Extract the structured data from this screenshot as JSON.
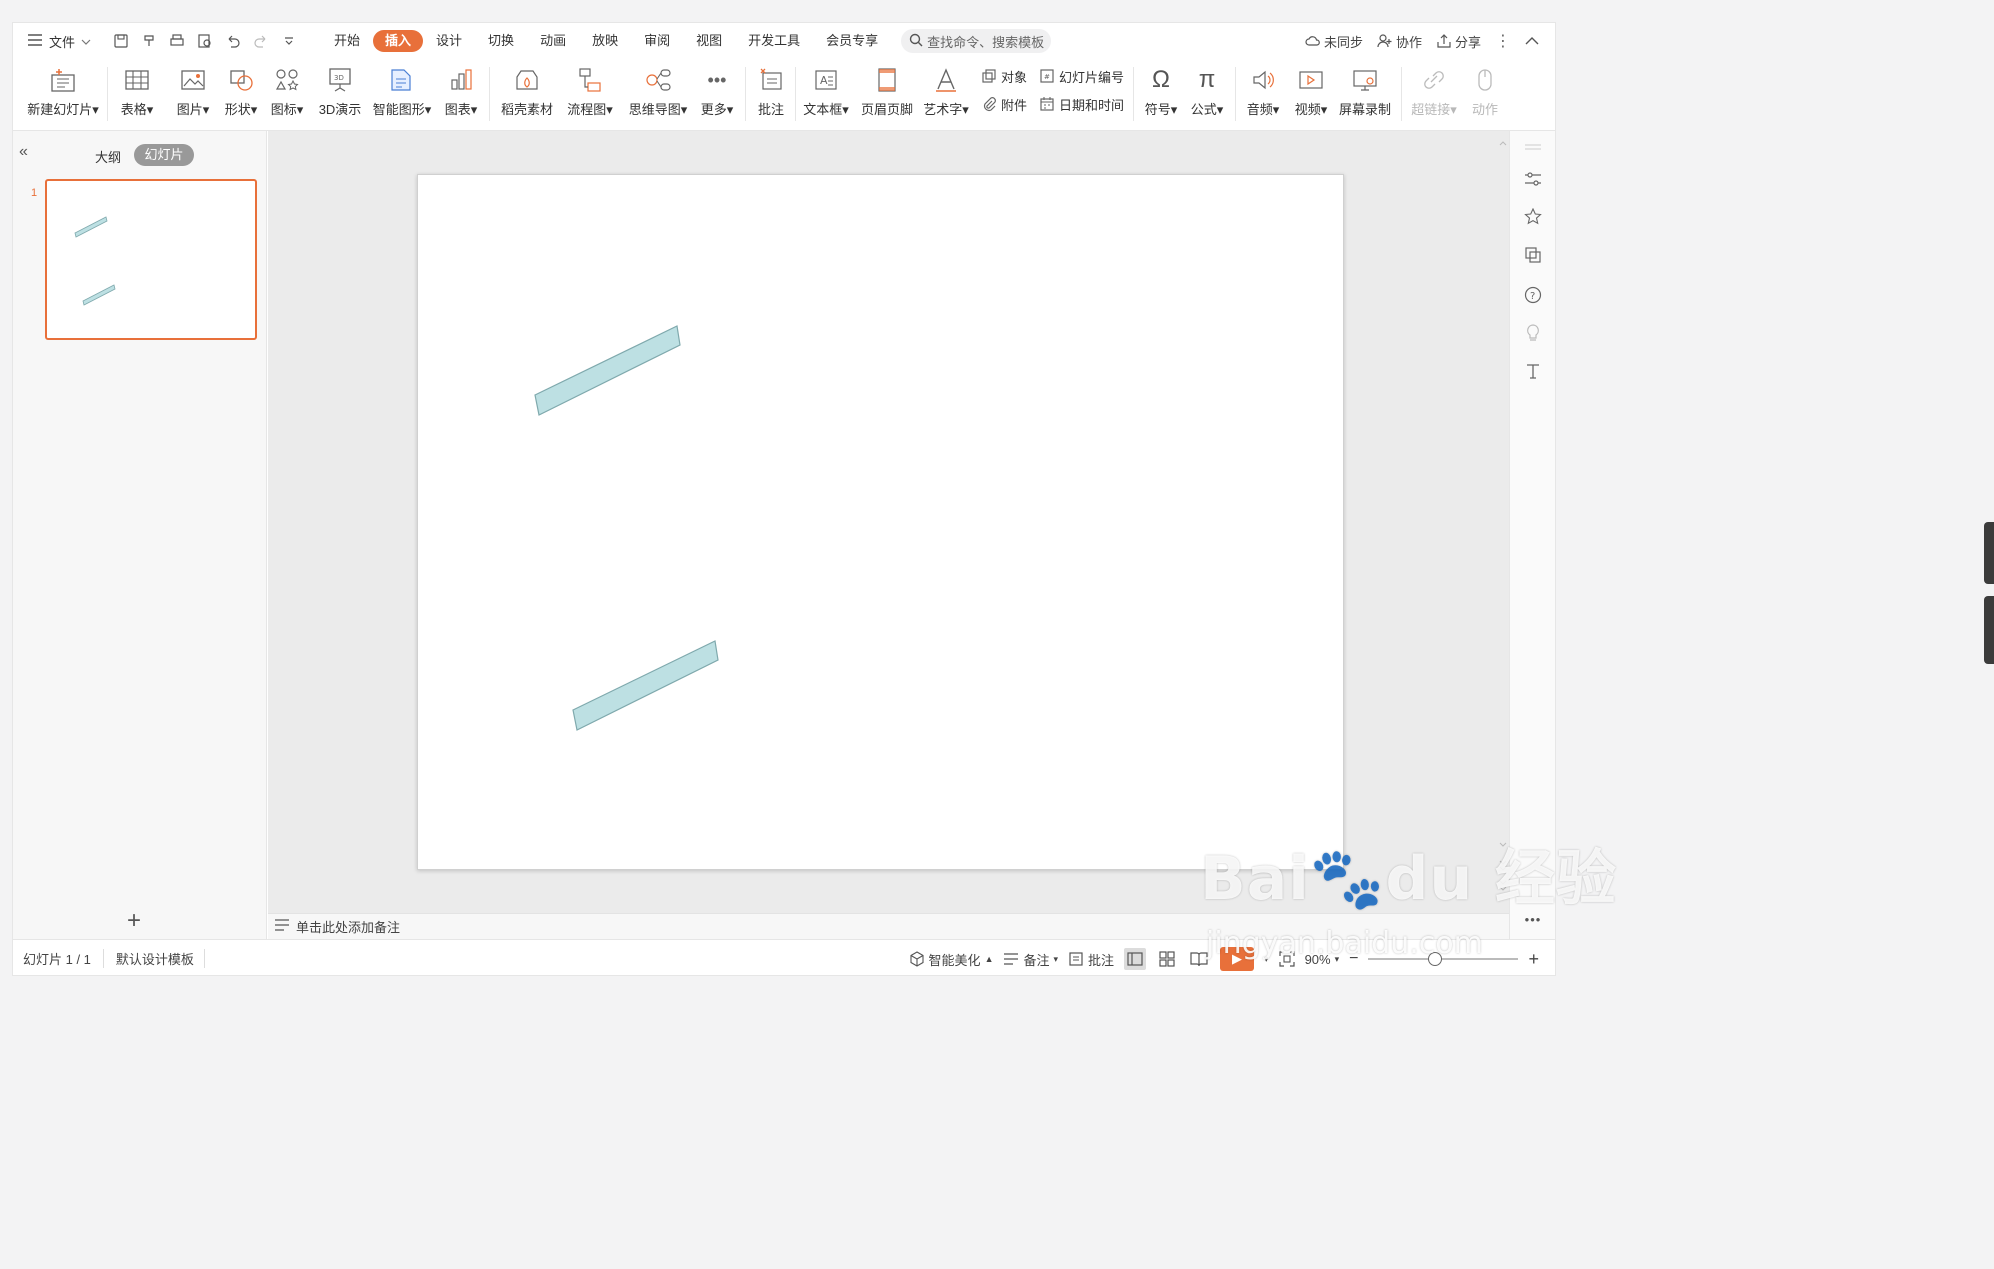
{
  "menubar": {
    "file_label": "文件",
    "tabs": [
      {
        "label": "开始"
      },
      {
        "label": "插入"
      },
      {
        "label": "设计"
      },
      {
        "label": "切换"
      },
      {
        "label": "动画"
      },
      {
        "label": "放映"
      },
      {
        "label": "审阅"
      },
      {
        "label": "视图"
      },
      {
        "label": "开发工具"
      },
      {
        "label": "会员专享"
      }
    ],
    "active_tab": "插入",
    "search_placeholder": "查找命令、搜索模板",
    "sync_label": "未同步",
    "collab_label": "协作",
    "share_label": "分享"
  },
  "ribbon": {
    "new_slide": "新建幻灯片",
    "table": "表格",
    "picture": "图片",
    "shape": "形状",
    "icon": "图标",
    "demo3d": "3D演示",
    "smartart": "智能图形",
    "chart": "图表",
    "material": "稻壳素材",
    "flowchart": "流程图",
    "mindmap": "思维导图",
    "more": "更多",
    "comment": "批注",
    "textbox": "文本框",
    "header_footer": "页眉页脚",
    "wordart": "艺术字",
    "object": "对象",
    "attachment": "附件",
    "slide_number": "幻灯片编号",
    "datetime": "日期和时间",
    "symbol": "符号",
    "formula": "公式",
    "audio": "音频",
    "video": "视频",
    "screen_record": "屏幕录制",
    "hyperlink": "超链接",
    "action": "动作"
  },
  "leftpanel": {
    "outline_label": "大纲",
    "slides_label": "幻灯片",
    "slide_number": "1"
  },
  "notes": {
    "placeholder": "单击此处添加备注"
  },
  "status": {
    "slide_info": "幻灯片 1 / 1",
    "template": "默认设计模板",
    "beautify": "智能美化",
    "notes": "备注",
    "comment": "批注",
    "zoom": "90%"
  },
  "slide": {
    "shape_fill": "#bde0e3",
    "shape_stroke": "#7fa9ad"
  },
  "colors": {
    "accent": "#e8703a"
  }
}
